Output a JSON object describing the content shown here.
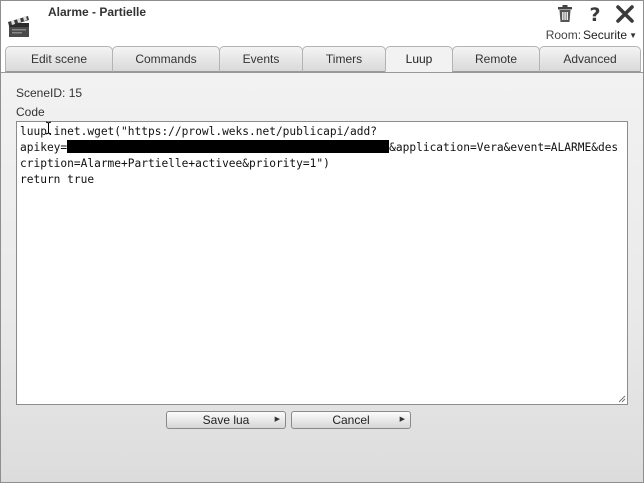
{
  "window": {
    "title": "Alarme - Partielle"
  },
  "header": {
    "room_label": "Room:",
    "room_value": "Securite",
    "icons": [
      "trash-icon",
      "help-icon",
      "close-icon",
      "clapperboard-icon"
    ]
  },
  "tabs": [
    {
      "label": "Edit scene"
    },
    {
      "label": "Commands"
    },
    {
      "label": "Events"
    },
    {
      "label": "Timers"
    },
    {
      "label": "Luup",
      "active": true
    },
    {
      "label": "Remote"
    },
    {
      "label": "Advanced"
    }
  ],
  "luup": {
    "scene_id_text": "SceneID: 15",
    "code_label": "Code",
    "code": {
      "line1": "luup.inet.wget(\"https://prowl.weks.net/publicapi/add?",
      "apikey_prefix": "apikey=",
      "apikey_redacted": "REDACTED",
      "after_key": "&application=Vera&event=ALARME&description=Alarme+Partielle+activee&priority=1\")",
      "line_last": "return true"
    },
    "save_button": "Save lua",
    "cancel_button": "Cancel"
  }
}
